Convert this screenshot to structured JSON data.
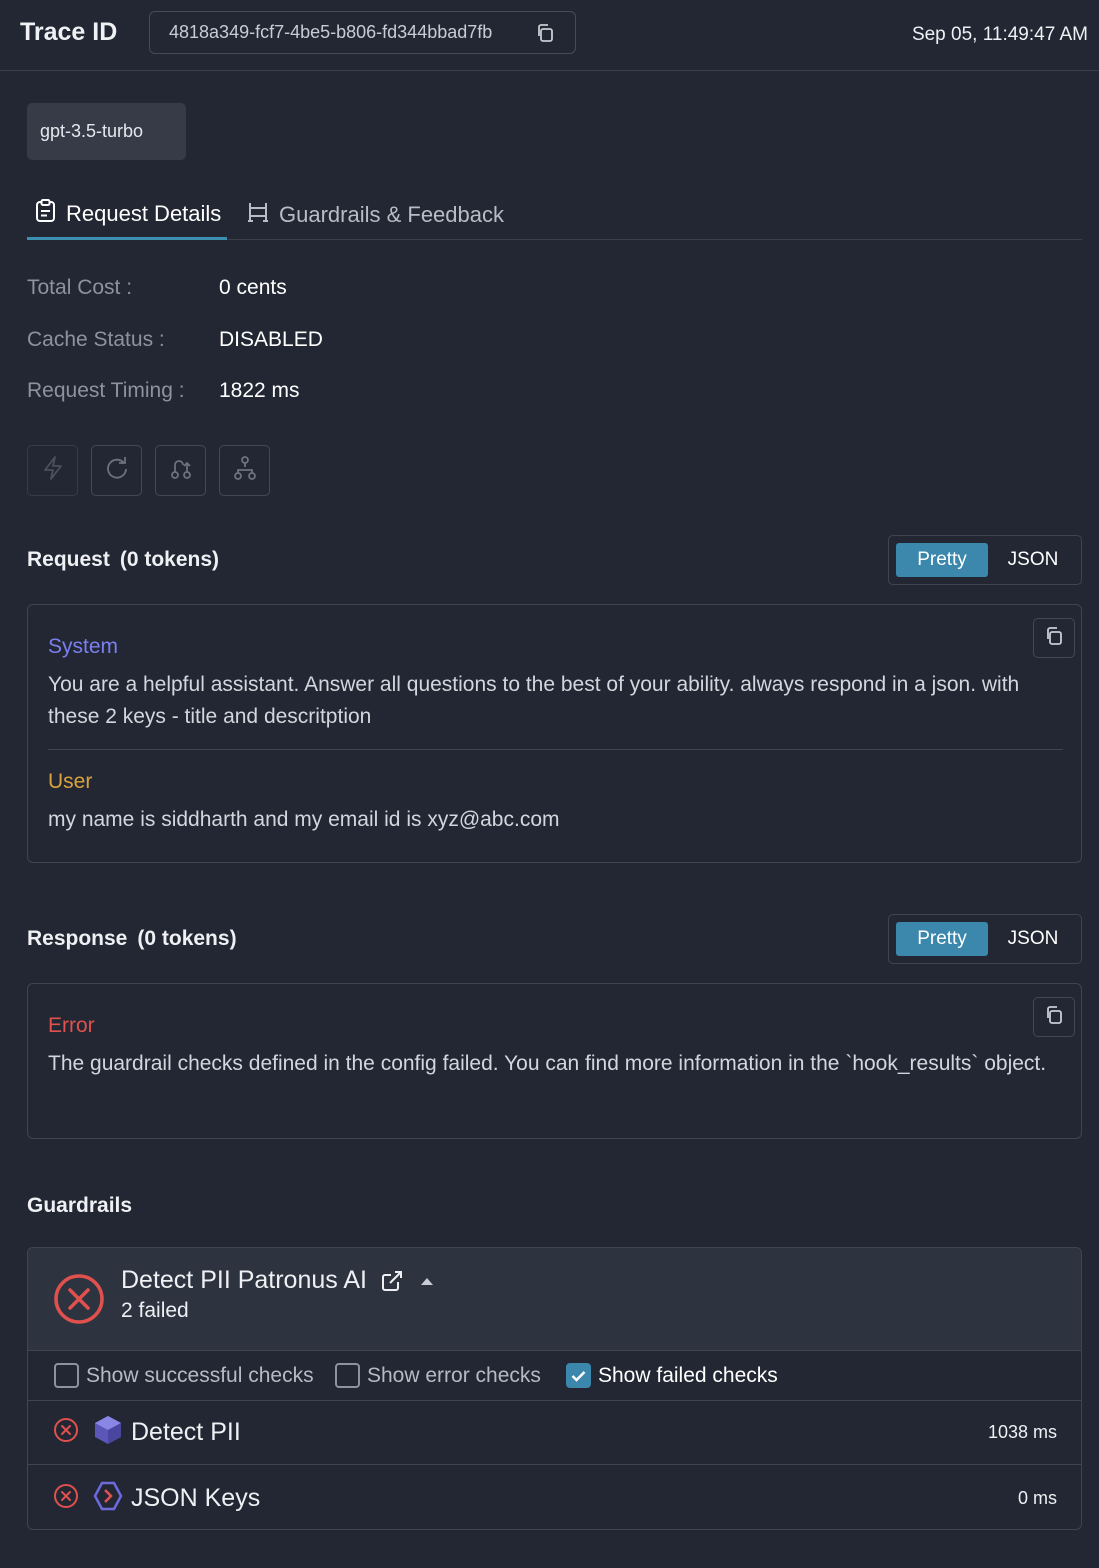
{
  "header": {
    "title": "Trace ID",
    "trace_id": "4818a349-fcf7-4be5-b806-fd344bbad7fb",
    "timestamp": "Sep 05, 11:49:47 AM"
  },
  "model": "gpt-3.5-turbo",
  "tabs": [
    {
      "label": "Request Details",
      "icon": "clipboard-icon",
      "active": true
    },
    {
      "label": "Guardrails & Feedback",
      "icon": "guardrail-icon",
      "active": false
    }
  ],
  "details": {
    "total_cost_label": "Total Cost :",
    "total_cost_value": "0 cents",
    "cache_status_label": "Cache Status :",
    "cache_status_value": "DISABLED",
    "request_timing_label": "Request Timing :",
    "request_timing_value": "1822 ms"
  },
  "action_icons": [
    "lightning-icon",
    "retry-icon",
    "fallback-icon",
    "loadbalance-icon"
  ],
  "request": {
    "title": "Request",
    "tokens": "(0 tokens)",
    "toggle": {
      "pretty": "Pretty",
      "json": "JSON"
    },
    "messages": [
      {
        "role": "System",
        "color": "#7b7ff0",
        "content": "You are a helpful assistant. Answer all questions to the best of your ability. always respond in a json. with these 2 keys - title and descritption"
      },
      {
        "role": "User",
        "color": "#d9a33b",
        "content": "my name is siddharth and my email id is xyz@abc.com"
      }
    ]
  },
  "response": {
    "title": "Response",
    "tokens": "(0 tokens)",
    "toggle": {
      "pretty": "Pretty",
      "json": "JSON"
    },
    "error_label": "Error",
    "error_color": "#e0514d",
    "error_message": "The guardrail checks defined in the config failed. You can find more information in the `hook_results` object."
  },
  "guardrails": {
    "title": "Guardrails",
    "group_name": "Detect PII Patronus AI",
    "group_status": "2 failed",
    "filters": [
      {
        "label": "Show successful checks",
        "checked": false
      },
      {
        "label": "Show error checks",
        "checked": false
      },
      {
        "label": "Show failed checks",
        "checked": true
      }
    ],
    "checks": [
      {
        "name": "Detect PII",
        "time": "1038 ms",
        "status": "failed",
        "logo": "patronus-cube-icon"
      },
      {
        "name": "JSON Keys",
        "time": "0 ms",
        "status": "failed",
        "logo": "json-keys-icon"
      }
    ]
  },
  "colors": {
    "accent": "#3b88ac",
    "error": "#e0514d",
    "background": "#232733"
  }
}
